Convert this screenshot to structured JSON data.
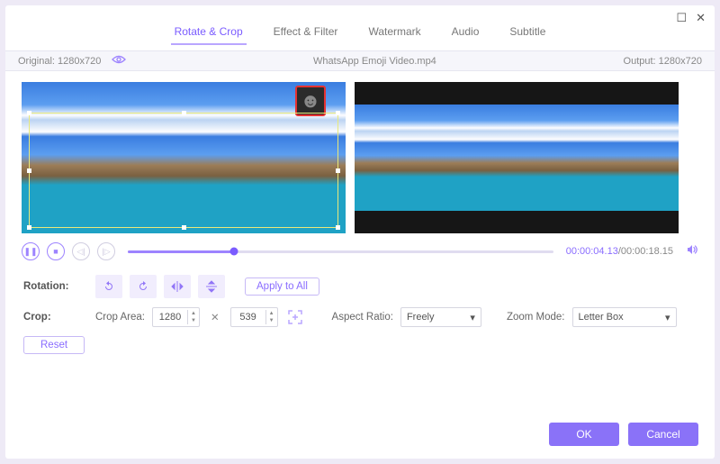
{
  "window": {
    "maximize": "☐",
    "close": "✕"
  },
  "tabs": [
    "Rotate & Crop",
    "Effect & Filter",
    "Watermark",
    "Audio",
    "Subtitle"
  ],
  "activeTab": 0,
  "infobar": {
    "originalLabel": "Original: 1280x720",
    "filename": "WhatsApp Emoji Video.mp4",
    "outputLabel": "Output: 1280x720"
  },
  "player": {
    "currentTime": "00:00:04.13",
    "totalTime": "/00:00:18.15"
  },
  "rotation": {
    "label": "Rotation:",
    "applyAll": "Apply to All"
  },
  "crop": {
    "label": "Crop:",
    "areaLabel": "Crop Area:",
    "width": "1280",
    "height": "539",
    "aspectLabel": "Aspect Ratio:",
    "aspectValue": "Freely",
    "zoomLabel": "Zoom Mode:",
    "zoomValue": "Letter Box",
    "reset": "Reset"
  },
  "footer": {
    "ok": "OK",
    "cancel": "Cancel"
  }
}
